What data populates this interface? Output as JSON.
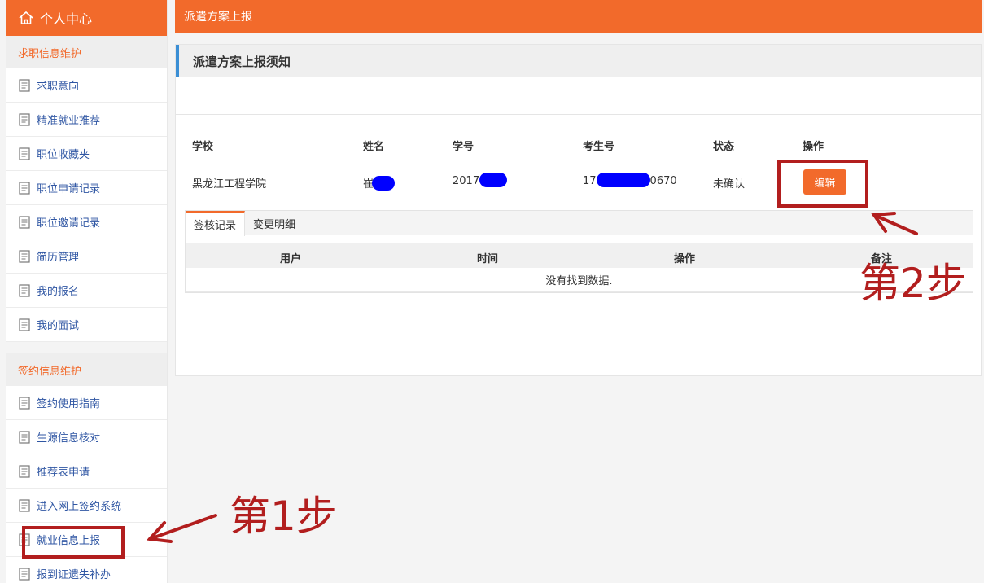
{
  "sidebar": {
    "header": "个人中心",
    "group1": {
      "title": "求职信息维护",
      "items": [
        "求职意向",
        "精准就业推荐",
        "职位收藏夹",
        "职位申请记录",
        "职位邀请记录",
        "简历管理",
        "我的报名",
        "我的面试"
      ]
    },
    "group2": {
      "title": "签约信息维护",
      "items": [
        "签约使用指南",
        "生源信息核对",
        "推荐表申请",
        "进入网上签约系统",
        "就业信息上报",
        "报到证遗失补办"
      ]
    }
  },
  "topbar": {
    "title": "派遣方案上报"
  },
  "panel": {
    "title": "派遣方案上报须知",
    "columns": [
      "学校",
      "姓名",
      "学号",
      "考生号",
      "状态",
      "操作"
    ],
    "row": {
      "school": "黑龙江工程学院",
      "name_prefix": "崔",
      "student_id_prefix": "2017",
      "exam_no_prefix": "17",
      "exam_no_suffix": "0670",
      "status": "未确认",
      "action": "编辑"
    },
    "tabs": [
      "签核记录",
      "变更明细"
    ],
    "records": {
      "columns": [
        "用户",
        "时间",
        "操作",
        "备注"
      ],
      "empty_text": "没有找到数据."
    }
  },
  "annotations": {
    "step1": "第1步",
    "step2": "第2步",
    "color": "#b21e1e"
  },
  "colors": {
    "brand": "#f26a2b",
    "link": "#2f56a3",
    "redaction": "#0000ff"
  }
}
